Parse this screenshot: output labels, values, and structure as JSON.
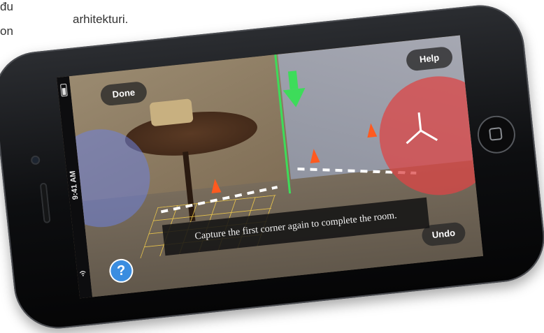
{
  "page": {
    "left_fragment_1": "đu",
    "left_fragment_2": "on",
    "heading_fragment": "arhitekturi."
  },
  "device": {
    "status": {
      "time": "9:41 AM"
    }
  },
  "app": {
    "done_label": "Done",
    "help_label": "Help",
    "undo_label": "Undo",
    "instruction": "Capture the first corner again to complete the room.",
    "help_icon_glyph": "?",
    "colors": {
      "guide_green": "#3ddc5a",
      "help_blue": "#3a8de0",
      "cone_orange": "#ff5a1f"
    }
  }
}
